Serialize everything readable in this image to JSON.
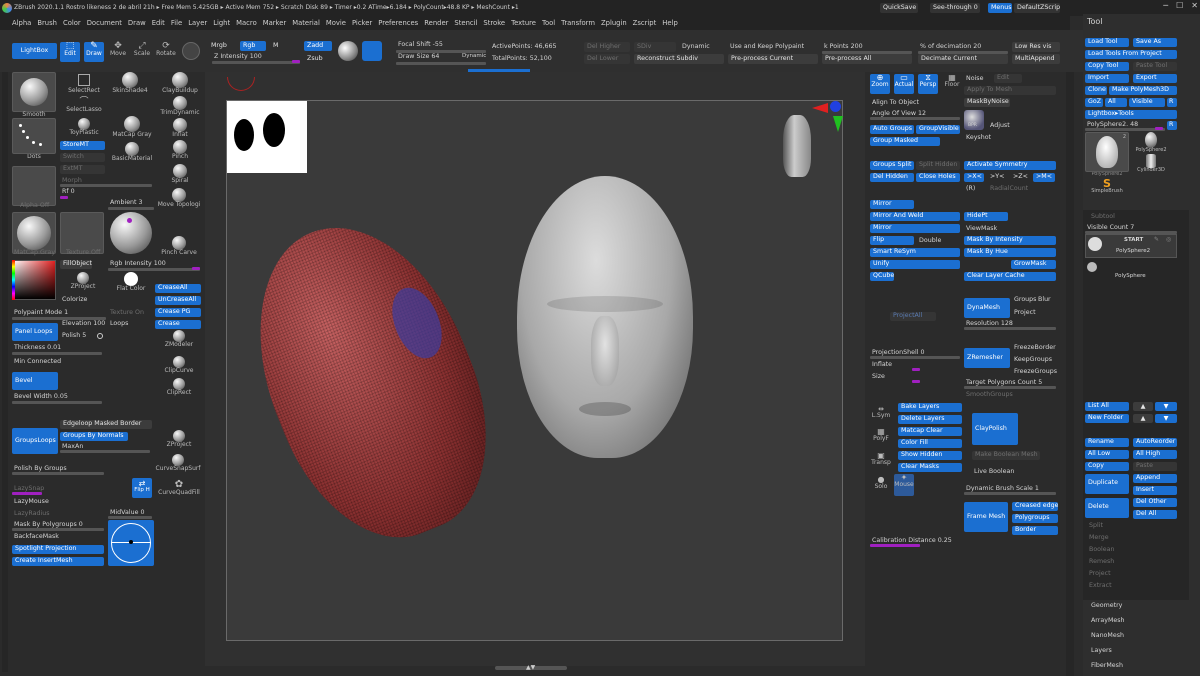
{
  "title_bar": {
    "logo": "zbrush-logo-icon",
    "info": "ZBrush 2020.1.1   Rostro likeness 2 de abril 21h  ▸ Free Mem 5.425GB ▸ Active Mem 752 ▸ Scratch Disk 89 ▸ Timer ▸0.2 ATime▸6.184 ▸ PolyCount▸48.8 KP ▸ MeshCount ▸1",
    "quicksave": "QuickSave",
    "seethrough": "See-through  0",
    "menus": "Menus",
    "script": "DefaultZScript"
  },
  "menu": [
    "Alpha",
    "Brush",
    "Color",
    "Document",
    "Draw",
    "Edit",
    "File",
    "Layer",
    "Light",
    "Macro",
    "Marker",
    "Material",
    "Movie",
    "Picker",
    "Preferences",
    "Render",
    "Stencil",
    "Stroke",
    "Texture",
    "Tool",
    "Transform",
    "Zplugin",
    "Zscript",
    "Help"
  ],
  "top_shelf": {
    "lightbox": "LightBox",
    "edit": "Edit",
    "draw": "Draw",
    "move": "Move",
    "scale": "Scale",
    "rotate": "Rotate",
    "mrgb": "Mrgb",
    "rgb": "Rgb",
    "m": "M",
    "zadd": "Zadd",
    "zsub": "Zsub",
    "zintensity": "Z Intensity 100",
    "focal": "Focal Shift -55",
    "drawsize": "Draw Size 64",
    "dynamic_label": "Dynamic",
    "active_points": "ActivePoints: 46,665",
    "total_points": "TotalPoints: 52,100",
    "del_higher": "Del Higher",
    "del_lower": "Del Lower",
    "sdiv": "SDiv",
    "dynamic": "Dynamic",
    "reconstruct": "Reconstruct Subdiv",
    "use_keep": "Use and Keep Polypaint",
    "preprocess_current": "Pre-process Current",
    "k_points": "k Points 200",
    "preprocess_all": "Pre-process All",
    "pct_decimation": "% of decimation 20",
    "decimate_current": "Decimate Current",
    "low_res_vis": "Low Res vis",
    "multiappend": "MultiAppend"
  },
  "left_panel": {
    "brushes": [
      "Smooth",
      "SelectRect",
      "SkinShade4",
      "ClayBuildup",
      "SelectLasso",
      "TrimDynamic",
      "ToyPlastic",
      "MatCap Gray",
      "Inflat",
      "Dots",
      "StoreMT",
      "BasicMaterial",
      "Pinch",
      "Switch",
      "Spiral",
      "ExtMT",
      "Morph",
      "Move Topologi",
      "Alpha Off",
      "Rf 0",
      "Ambient 3",
      "MatCap Gray",
      "Texture Off",
      "Pinch Carve",
      "FillObject",
      "Rgb Intensity 100",
      "Colorize",
      "ZProject",
      "Flat Color"
    ],
    "crease_all": "CreaseAll",
    "uncrease_all": "UnCreaseAll",
    "crease_pg": "Crease PG",
    "crease": "Crease",
    "polypaint_mode": "Polypaint Mode 1",
    "texture_on": "Texture On",
    "panel_loops": "Panel Loops",
    "elevation": "Elevation 100",
    "loops": "Loops",
    "polish": "Polish 5",
    "thickness": "Thickness 0.01",
    "min_connected": "Min Connected",
    "bevel": "Bevel",
    "bevel_width": "Bevel Width 0.05",
    "edgeloop_masked": "Edgeloop Masked Border",
    "groups_loops": "GroupsLoops",
    "groups_by_normals": "Groups By Normals",
    "maxan": "MaxAn",
    "polish_by_groups": "Polish By Groups",
    "lazysnap": "LazySnap",
    "lazymouse": "LazyMouse",
    "lazyradius": "LazyRadius",
    "flip_h": "Flip H",
    "curvequadfill": "CurveQuadFill",
    "mask_by_pg": "Mask By Polygroups 0",
    "midvalue": "MidValue 0",
    "backfacemask": "BackfaceMask",
    "spotlight": "Spotlight Projection",
    "create_insertmesh": "Create InsertMesh",
    "zmodeler": "ZModeler",
    "clipcurve": "ClipCurve",
    "cliprect": "ClipRect",
    "zproject2": "ZProject",
    "curvesnapsurf": "CurveSnapSurf"
  },
  "viewport_tools": {
    "zoom": "Zoom",
    "actual": "Actual",
    "persp": "Persp",
    "floor": "Floor",
    "align_to_object": "Align To Object",
    "angle_of_view": "Angle Of View 12",
    "noise": "Noise",
    "edit": "Edit",
    "apply_to_mesh": "Apply To Mesh",
    "mask_by_noise": "MaskByNoise",
    "adjust": "Adjust",
    "keyshot": "Keyshot",
    "bpr": "BPR",
    "auto_groups": "Auto Groups",
    "group_visible": "GroupVisible",
    "group_masked": "Group Masked",
    "groups_split": "Groups Split",
    "split_hidden": "Split Hidden",
    "activate_symmetry": "Activate Symmetry",
    "del_hidden": "Del Hidden",
    "close_holes": "Close Holes",
    "sym_x": ">X<",
    "sym_y": ">Y<",
    "sym_z": ">Z<",
    "sym_m": ">M<",
    "r": "(R)",
    "radial_count": "RadialCount",
    "mirror": "Mirror",
    "mirror_and_weld": "Mirror And Weld",
    "mirror2": "Mirror",
    "flip": "Flip",
    "double": "Double",
    "smart_resym": "Smart ReSym",
    "unify": "Unify",
    "qcube": "QCube",
    "hidept": "HidePt",
    "viewmask": "ViewMask",
    "mask_by_intensity": "Mask By Intensity",
    "mask_by_hue": "Mask By Hue",
    "growmask": "GrowMask",
    "clear_layer_cache": "Clear Layer Cache",
    "dynamesh": "DynaMesh",
    "groups": "Groups",
    "blur": "Blur",
    "project": "Project",
    "resolution": "Resolution 128",
    "projectall": "ProjectAll",
    "projection_shell": "ProjectionShell 0",
    "inflate": "Inflate",
    "size": "Size",
    "zremesher": "ZRemesher",
    "freezeborder": "FreezeBorder",
    "keepgroups": "KeepGroups",
    "freezegroups": "FreezeGroups",
    "target_polygons": "Target Polygons Count 5",
    "smoothgroups": "SmoothGroups",
    "bake_layers": "Bake Layers",
    "delete_layers": "Delete Layers",
    "matcap_clear": "Matcap Clear",
    "color_fill": "Color Fill",
    "show_hidden": "Show Hidden",
    "clear_masks": "Clear Masks",
    "lsym": "L.Sym",
    "polyf": "PolyF",
    "transp": "Transp",
    "solo": "Solo",
    "mouse": "Mouse",
    "claypolish": "ClayPolish",
    "make_boolean_mesh": "Make Boolean Mesh",
    "live_boolean": "Live Boolean",
    "dynamic_brush_scale": "Dynamic Brush Scale 1",
    "frame_mesh": "Frame Mesh",
    "creased_edges": "Creased edges",
    "polygroups": "Polygroups",
    "border": "Border",
    "calibration_distance": "Calibration Distance 0.25"
  },
  "tool_panel": {
    "title": "Tool",
    "load_tool": "Load Tool",
    "save_as": "Save As",
    "load_from_project": "Load Tools From Project",
    "copy_tool": "Copy Tool",
    "paste_tool": "Paste Tool",
    "import": "Import",
    "export": "Export",
    "clone": "Clone",
    "make_polymesh": "Make PolyMesh3D",
    "goz": "GoZ",
    "all": "All",
    "visible": "Visible",
    "r": "R",
    "lightbox_tools": "Lightbox▸Tools",
    "polysphere_slider": "PolySphere2. 48",
    "thumbs": [
      {
        "label": "PolySphere2",
        "count": "2"
      },
      {
        "label": "PolySphere2",
        "count": ""
      },
      {
        "label": "PolySphere2",
        "count": ""
      },
      {
        "label": "Cylinder3D",
        "count": ""
      },
      {
        "label": "SimpleBrush",
        "count": ""
      }
    ],
    "subtool_header": "Subtool",
    "visible_count": "Visible Count 7",
    "start": "START",
    "subtools": [
      "PolySphere2",
      "PolySphere"
    ],
    "list_all": "List All",
    "new_folder": "New Folder",
    "rename": "Rename",
    "autoreorder": "AutoReorder",
    "all_low": "All Low",
    "all_high": "All High",
    "copy": "Copy",
    "paste": "Paste",
    "duplicate": "Duplicate",
    "append": "Append",
    "insert": "Insert",
    "delete": "Delete",
    "del_other": "Del Other",
    "del_all": "Del All",
    "split": "Split",
    "merge": "Merge",
    "boolean": "Boolean",
    "remesh": "Remesh",
    "project": "Project",
    "extract": "Extract",
    "geometry": "Geometry",
    "arraymesh": "ArrayMesh",
    "nanomesh": "NanoMesh",
    "layers": "Layers",
    "fibermesh": "FiberMesh"
  },
  "colors": {
    "accent_blue": "#1b6fd1",
    "slider_purple": "#a020c0",
    "panel": "#2e2e2e",
    "bg": "#2b2b2b"
  }
}
